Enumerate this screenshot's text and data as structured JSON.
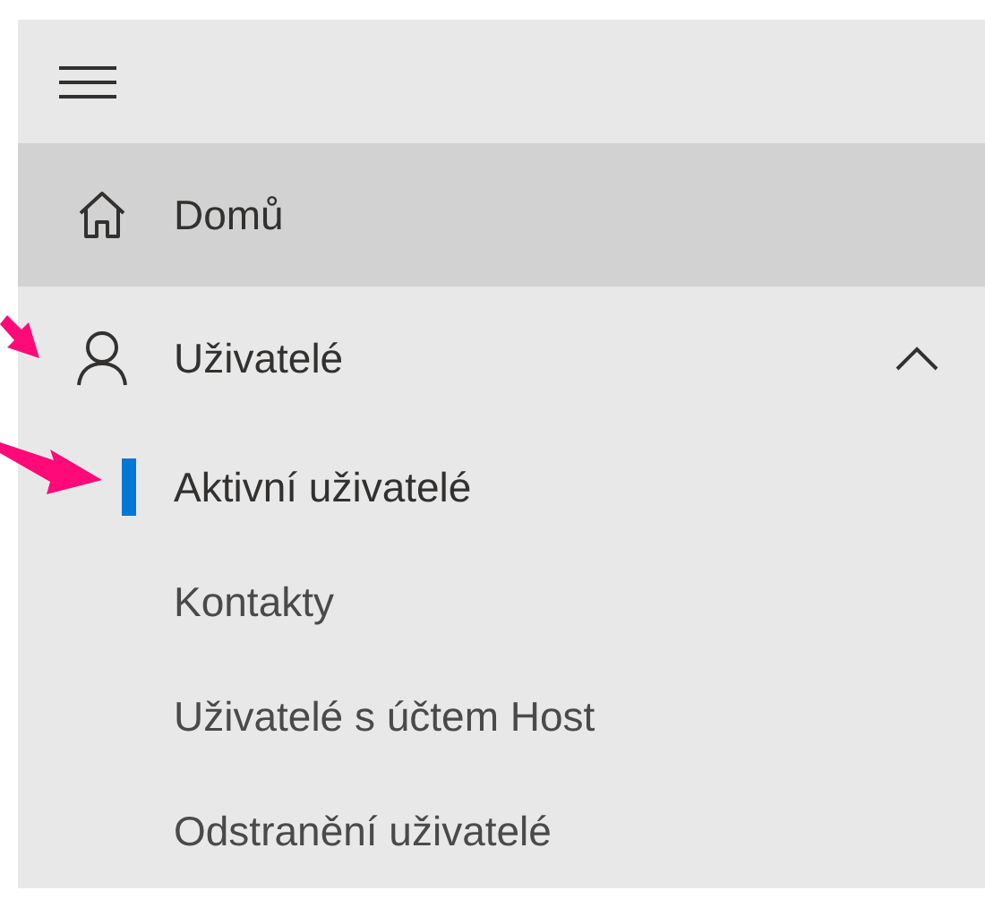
{
  "nav": {
    "items": [
      {
        "kind": "link",
        "label": "Domů",
        "highlighted": true
      },
      {
        "kind": "group",
        "label": "Uživatelé",
        "highlighted": false,
        "expanded": true,
        "children": [
          {
            "label": "Aktivní uživatelé",
            "selected": true
          },
          {
            "label": "Kontakty",
            "selected": false
          },
          {
            "label": "Uživatelé s účtem Host",
            "selected": false
          },
          {
            "label": "Odstranění uživatelé",
            "selected": false
          }
        ]
      }
    ]
  }
}
